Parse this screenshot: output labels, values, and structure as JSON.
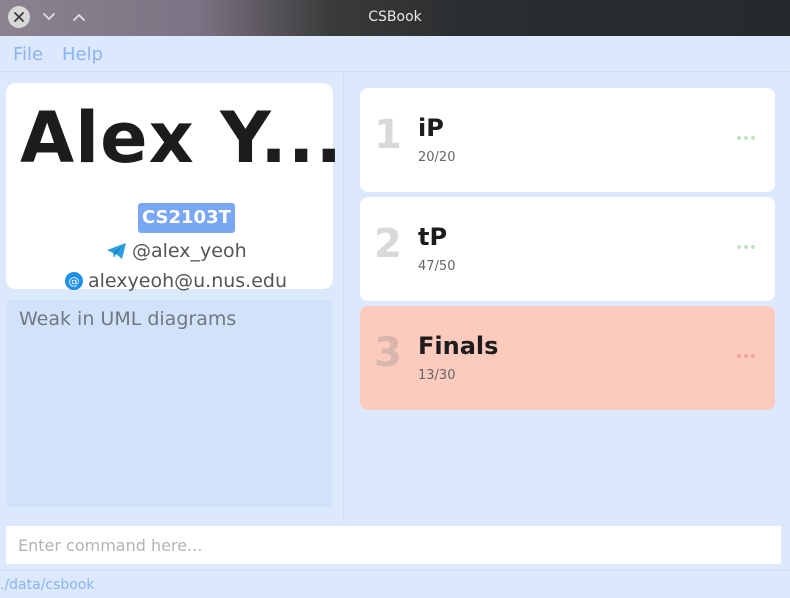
{
  "window": {
    "title": "CSBook",
    "controls": [
      "close-icon",
      "chevron-down-icon",
      "chevron-up-icon"
    ]
  },
  "menu": {
    "file": "File",
    "help": "Help"
  },
  "profile": {
    "name": "Alex Y...",
    "tag": "CS2103T",
    "telegram": "@alex_yeoh",
    "email": "alexyeoh@u.nus.edu",
    "notes": "Weak in UML diagrams"
  },
  "assessments": [
    {
      "index": "1",
      "name": "iP",
      "score": "20/20",
      "status": "normal"
    },
    {
      "index": "2",
      "name": "tP",
      "score": "47/50",
      "status": "normal"
    },
    {
      "index": "3",
      "name": "Finals",
      "score": "13/30",
      "status": "alert"
    }
  ],
  "command": {
    "placeholder": "Enter command here..."
  },
  "status": {
    "path": "./data/csbook"
  },
  "colors": {
    "accent": "#7aa7f4",
    "alert_card": "#fccbbd",
    "background": "#dce8fb"
  }
}
